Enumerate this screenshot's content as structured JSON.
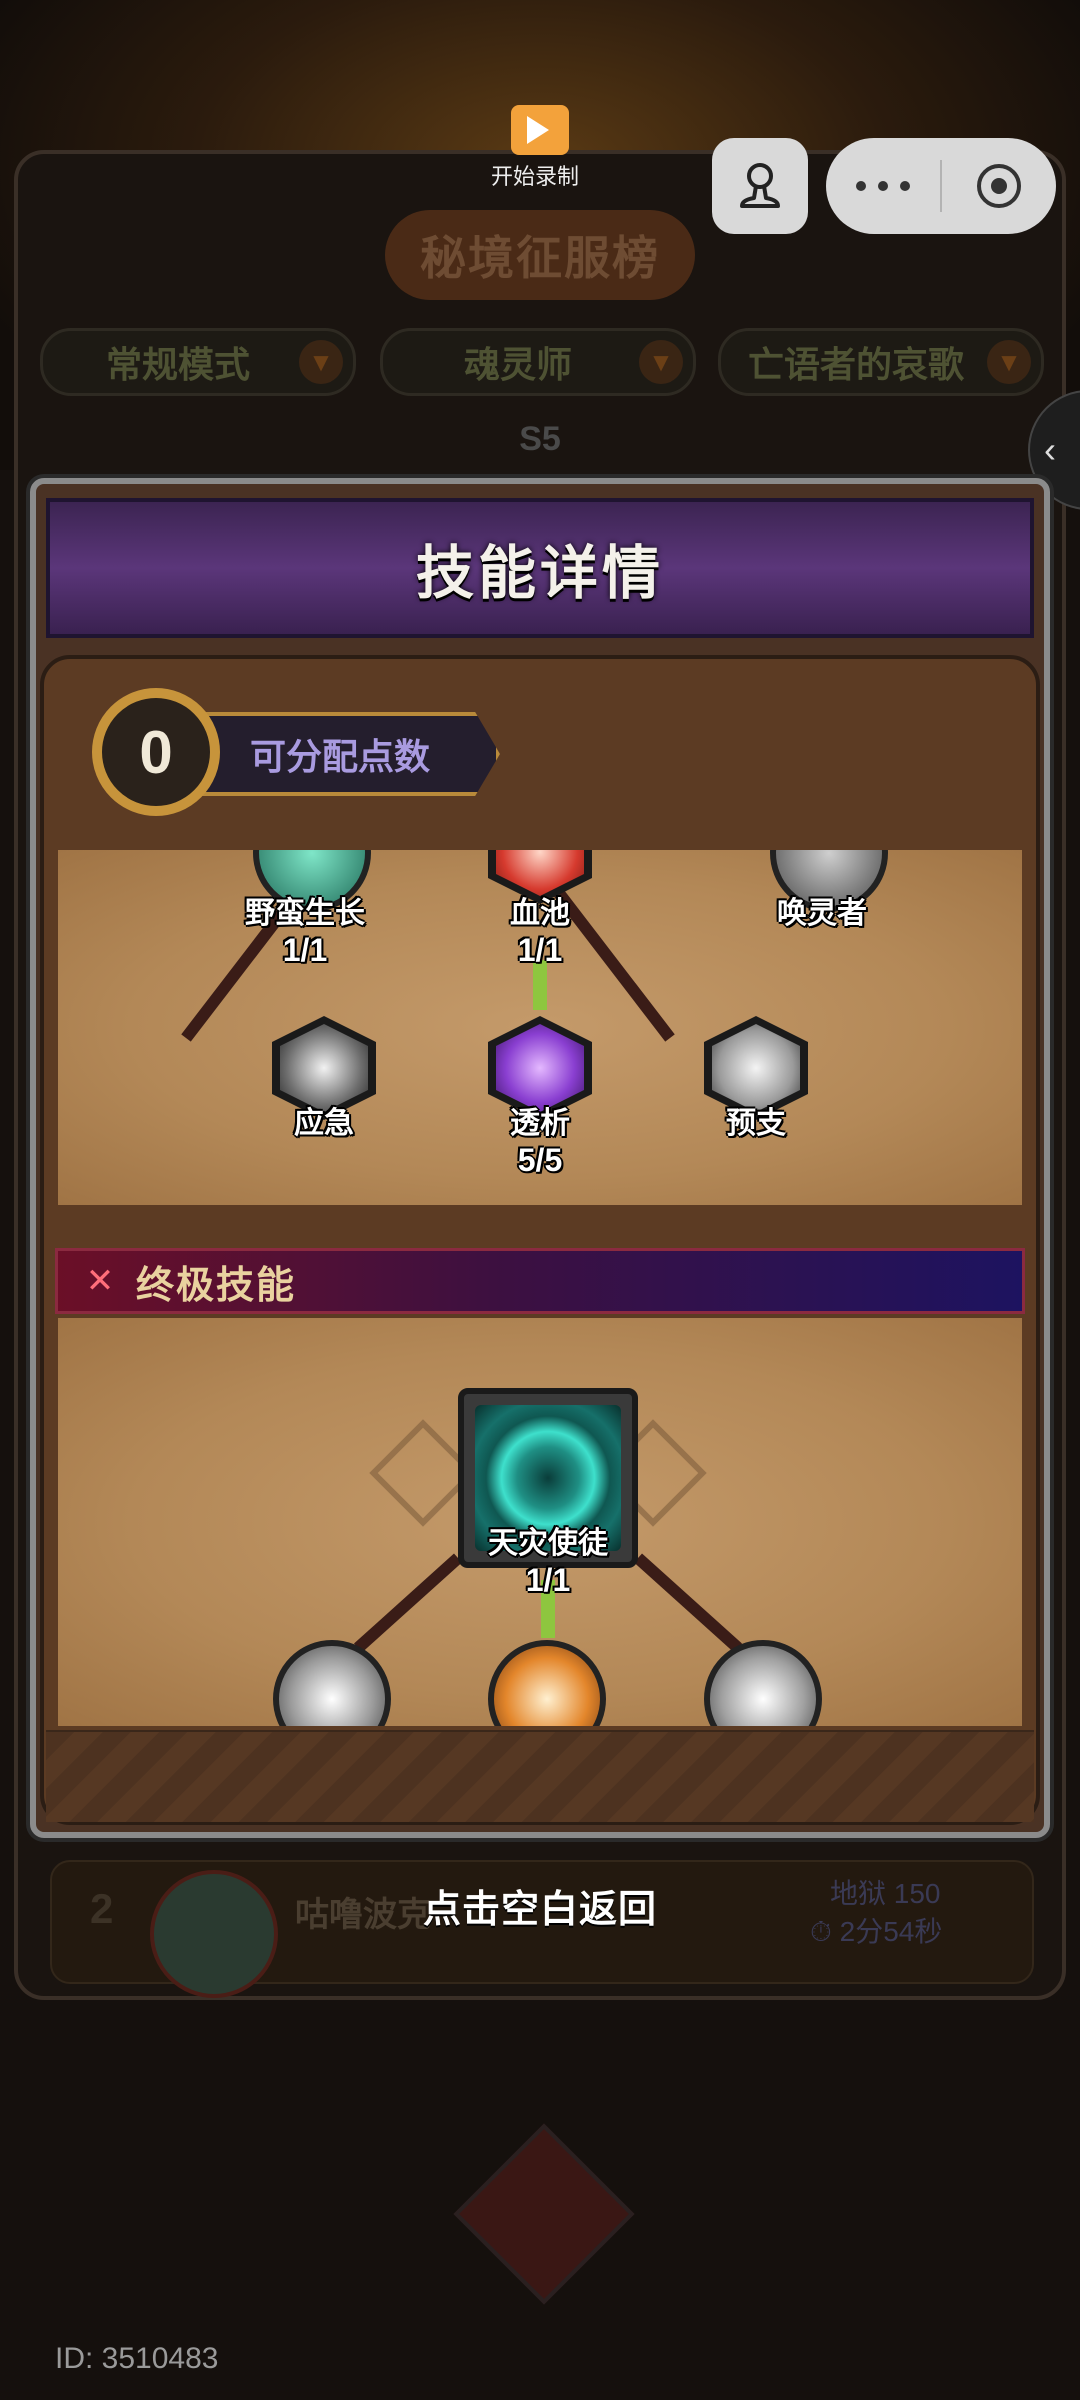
{
  "background": {
    "leaderboard_title": "秘境征服榜",
    "filters": [
      {
        "label": "常规模式"
      },
      {
        "label": "魂灵师"
      },
      {
        "label": "亡语者的哀歌"
      }
    ],
    "season": "S5",
    "row": {
      "rank": "2",
      "name": "咕噜波克",
      "stat": "地狱 150",
      "time": "2分54秒"
    }
  },
  "record": {
    "label": "开始录制"
  },
  "modal": {
    "title": "技能详情",
    "points": {
      "value": "0",
      "label": "可分配点数"
    },
    "tree": {
      "top_row": [
        {
          "name": "野蛮生长",
          "count": "1/1"
        },
        {
          "name": "血池",
          "count": "1/1"
        },
        {
          "name": "唤灵者",
          "count": ""
        }
      ],
      "second_row": [
        {
          "name": "应急",
          "count": ""
        },
        {
          "name": "透析",
          "count": "5/5"
        },
        {
          "name": "预支",
          "count": ""
        }
      ]
    },
    "ultimate": {
      "section_title": "终极技能",
      "main": {
        "name": "天灾使徒",
        "count": "1/1"
      }
    }
  },
  "hint": "点击空白返回",
  "user_id": "ID: 3510483",
  "colors": {
    "accent_gold": "#c7943b",
    "header_purple": "#5b367a",
    "link_green": "#8ec63f",
    "link_dark": "#3a1c17"
  }
}
